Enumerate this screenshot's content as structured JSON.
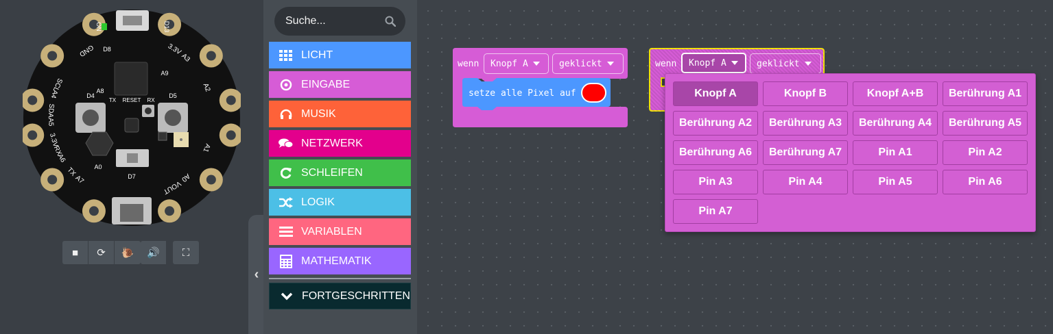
{
  "simulator": {
    "board_labels": {
      "gnd": "GND",
      "scl": "SCL",
      "a4": "A4",
      "sda": "SDA",
      "a5": "A5",
      "v33": "3.3V",
      "rx": "RX",
      "a6": "A6",
      "tx": "TX",
      "a7": "A7",
      "a3": "A3",
      "a2": "A2",
      "a1": "A1",
      "a0": "A0",
      "vout": "VOUT",
      "v33r": "3.3V",
      "d13": "D13",
      "d8": "D8",
      "a9": "A9",
      "a8": "A8",
      "d4": "D4",
      "d5": "D5",
      "reset": "RESET",
      "txs": "TX",
      "rxs": "RX",
      "d7": "D7",
      "a0b": "A0",
      "on": "ON"
    },
    "buttons": [
      "stop-icon",
      "restart-icon",
      "slowmo-icon",
      "sound-icon",
      "fullscreen-icon"
    ],
    "collapse_icon": "chevron-left-icon"
  },
  "toolbox": {
    "search_placeholder": "Suche...",
    "categories": [
      {
        "label": "LICHT",
        "color": "#4c97ff",
        "icon": "grid-icon"
      },
      {
        "label": "EINGABE",
        "color": "#d65cd6",
        "icon": "target-icon"
      },
      {
        "label": "MUSIK",
        "color": "#fe6239",
        "icon": "headphones-icon"
      },
      {
        "label": "NETZWERK",
        "color": "#e3008c",
        "icon": "chat-icon"
      },
      {
        "label": "SCHLEIFEN",
        "color": "#40bf4a",
        "icon": "refresh-icon"
      },
      {
        "label": "LOGIK",
        "color": "#4cbfe6",
        "icon": "shuffle-icon"
      },
      {
        "label": "VARIABLEN",
        "color": "#ff6680",
        "icon": "list-icon"
      },
      {
        "label": "MATHEMATIK",
        "color": "#9966ff",
        "icon": "calculator-icon"
      }
    ],
    "advanced": {
      "label": "FORTGESCHRITTEN",
      "color": "#092a2f",
      "icon": "chevron-down-icon"
    }
  },
  "workspace": {
    "block1": {
      "when": "wenn",
      "button": "Knopf A",
      "event": "geklickt",
      "statement": "setze alle Pixel auf",
      "pixel_color": "#ff0000"
    },
    "block2": {
      "when": "wenn",
      "button": "Knopf A",
      "event": "geklickt"
    },
    "menu": {
      "selected": "Knopf A",
      "options": [
        "Knopf A",
        "Knopf B",
        "Knopf A+B",
        "Berührung A1",
        "Berührung A2",
        "Berührung A3",
        "Berührung A4",
        "Berührung A5",
        "Berührung A6",
        "Berührung A7",
        "Pin A1",
        "Pin A2",
        "Pin A3",
        "Pin A4",
        "Pin A5",
        "Pin A6",
        "Pin A7"
      ]
    }
  },
  "colors": {
    "input_block": "#d65cd6",
    "light_block": "#4c97ff",
    "highlight": "#f5e50a"
  }
}
